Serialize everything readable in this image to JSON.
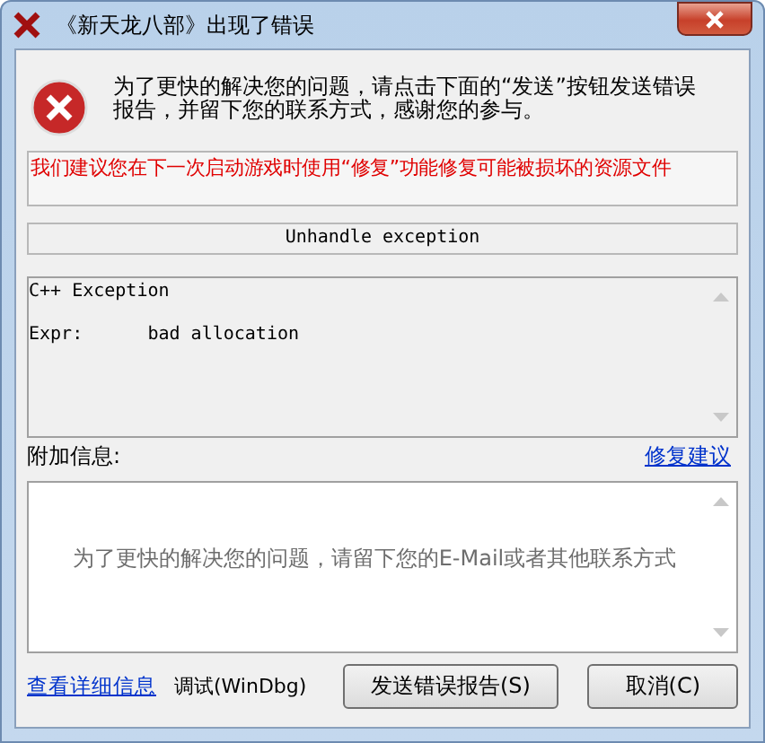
{
  "window": {
    "title": "《新天龙八部》出现了错误"
  },
  "message": "为了更快的解决您的问题，请点击下面的“发送”按钮发送错误报告，并留下您的联系方式，感谢您的参与。",
  "notice": "我们建议您在下一次启动游戏时使用“修复”功能修复可能被损坏的资源文件",
  "exception_title": "Unhandle exception",
  "details": [
    "C++ Exception",
    "Expr:      bad allocation"
  ],
  "additional_info": {
    "label": "附加信息:",
    "link": "修复建议",
    "placeholder": "为了更快的解决您的问题，请留下您的E-Mail或者其他联系方式"
  },
  "footer": {
    "details_link": "查看详细信息",
    "debug_label": "调试(WinDbg)"
  },
  "buttons": [
    "发送错误报告(S)",
    "取消(C)"
  ]
}
